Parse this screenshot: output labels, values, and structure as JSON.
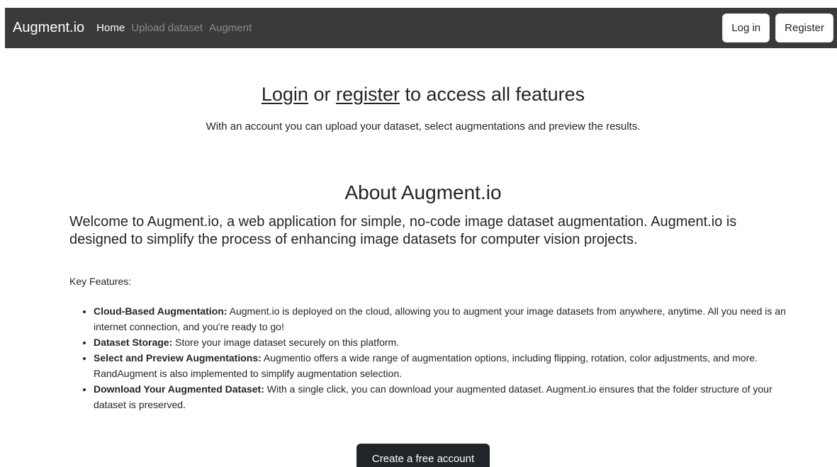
{
  "navbar": {
    "brand": "Augment.io",
    "links": [
      {
        "label": "Home"
      },
      {
        "label": "Upload dataset"
      },
      {
        "label": "Augment"
      }
    ],
    "login_label": "Log in",
    "register_label": "Register"
  },
  "hero": {
    "login_link": "Login",
    "or_text": " or ",
    "register_link": "register",
    "title_rest": " to access all features",
    "subtitle": "With an account you can upload your dataset, select augmentations and preview the results."
  },
  "about": {
    "title": "About Augment.io",
    "welcome": "Welcome to Augment.io, a web application for simple, no-code image dataset augmentation. Augment.io is designed to simplify the process of enhancing image datasets for computer vision projects.",
    "key_features_label": "Key Features:",
    "features": [
      {
        "title": "Cloud-Based Augmentation:",
        "text": " Augment.io is deployed on the cloud, allowing you to augment your image datasets from anywhere, anytime. All you need is an internet connection, and you're ready to go!"
      },
      {
        "title": "Dataset Storage:",
        "text": " Store your image dataset securely on this platform."
      },
      {
        "title": "Select and Preview Augmentations:",
        "text": " Augmentio offers a wide range of augmentation options, including flipping, rotation, color adjustments, and more. RandAugment is also implemented to simplify augmentation selection."
      },
      {
        "title": "Download Your Augmented Dataset:",
        "text": " With a single click, you can download your augmented dataset. Augment.io ensures that the folder structure of your dataset is preserved."
      }
    ],
    "cta_label": "Create a free account"
  },
  "colors": {
    "navbar_bg": "#3a3a3a",
    "text": "#212529",
    "muted_link": "#8a8a8a",
    "cta_bg": "#212529"
  }
}
